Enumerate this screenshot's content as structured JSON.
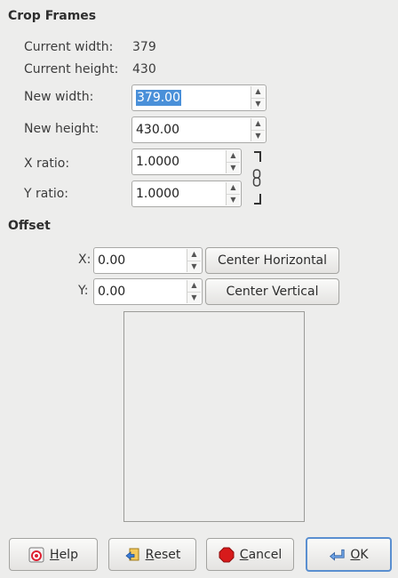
{
  "crop": {
    "title": "Crop Frames",
    "current_width_label": "Current width:",
    "current_width_value": "379",
    "current_height_label": "Current height:",
    "current_height_value": "430",
    "new_width_label": "New width:",
    "new_width_value": "379.00",
    "new_height_label": "New height:",
    "new_height_value": "430.00",
    "x_ratio_label": "X ratio:",
    "x_ratio_value": "1.0000",
    "y_ratio_label": "Y ratio:",
    "y_ratio_value": "1.0000",
    "chain_icon": "chain-link-icon"
  },
  "offset": {
    "title": "Offset",
    "x_label": "X:",
    "x_value": "0.00",
    "y_label": "Y:",
    "y_value": "0.00",
    "center_horizontal_label": "Center Horizontal",
    "center_vertical_label": "Center Vertical"
  },
  "buttons": {
    "help_first": "H",
    "help_rest": "elp",
    "reset_first": "R",
    "reset_rest": "eset",
    "cancel_first": "C",
    "cancel_rest": "ancel",
    "ok_first": "O",
    "ok_rest": "K"
  },
  "colors": {
    "background": "#ededec",
    "selection": "#4a90d9",
    "default_button_border": "#5a8fd0",
    "cancel_icon": "#d71b1b"
  }
}
